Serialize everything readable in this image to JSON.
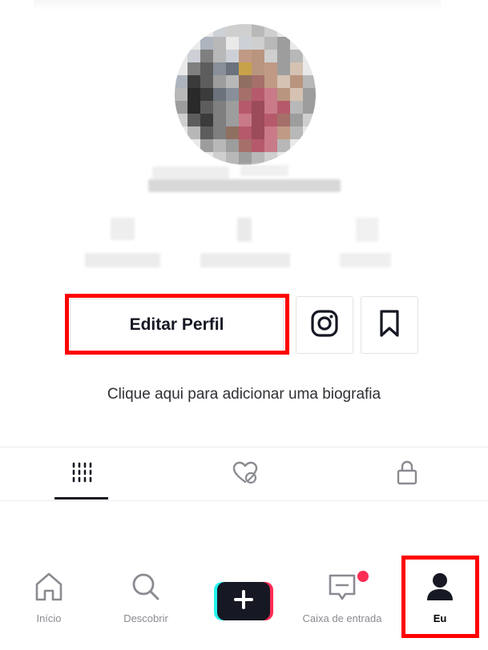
{
  "profile": {
    "edit_label": "Editar Perfil",
    "bio_prompt": "Clique aqui para adicionar uma biografia"
  },
  "tabs": [
    {
      "icon": "grid-icon",
      "active": true
    },
    {
      "icon": "liked-hidden-icon",
      "active": false
    },
    {
      "icon": "lock-icon",
      "active": false
    }
  ],
  "nav": {
    "items": [
      {
        "label": "Início",
        "icon": "home-icon"
      },
      {
        "label": "Descobrir",
        "icon": "search-icon"
      },
      {
        "label": "",
        "icon": "plus-icon"
      },
      {
        "label": "Caixa de entrada",
        "icon": "inbox-icon"
      },
      {
        "label": "Eu",
        "icon": "profile-icon",
        "active": true
      }
    ]
  },
  "colors": {
    "highlight": "#ff0000",
    "text": "#161823",
    "notification_dot": "#fe2c55",
    "plus_cyan": "#25f4ee",
    "plus_pink": "#fe2c55"
  }
}
